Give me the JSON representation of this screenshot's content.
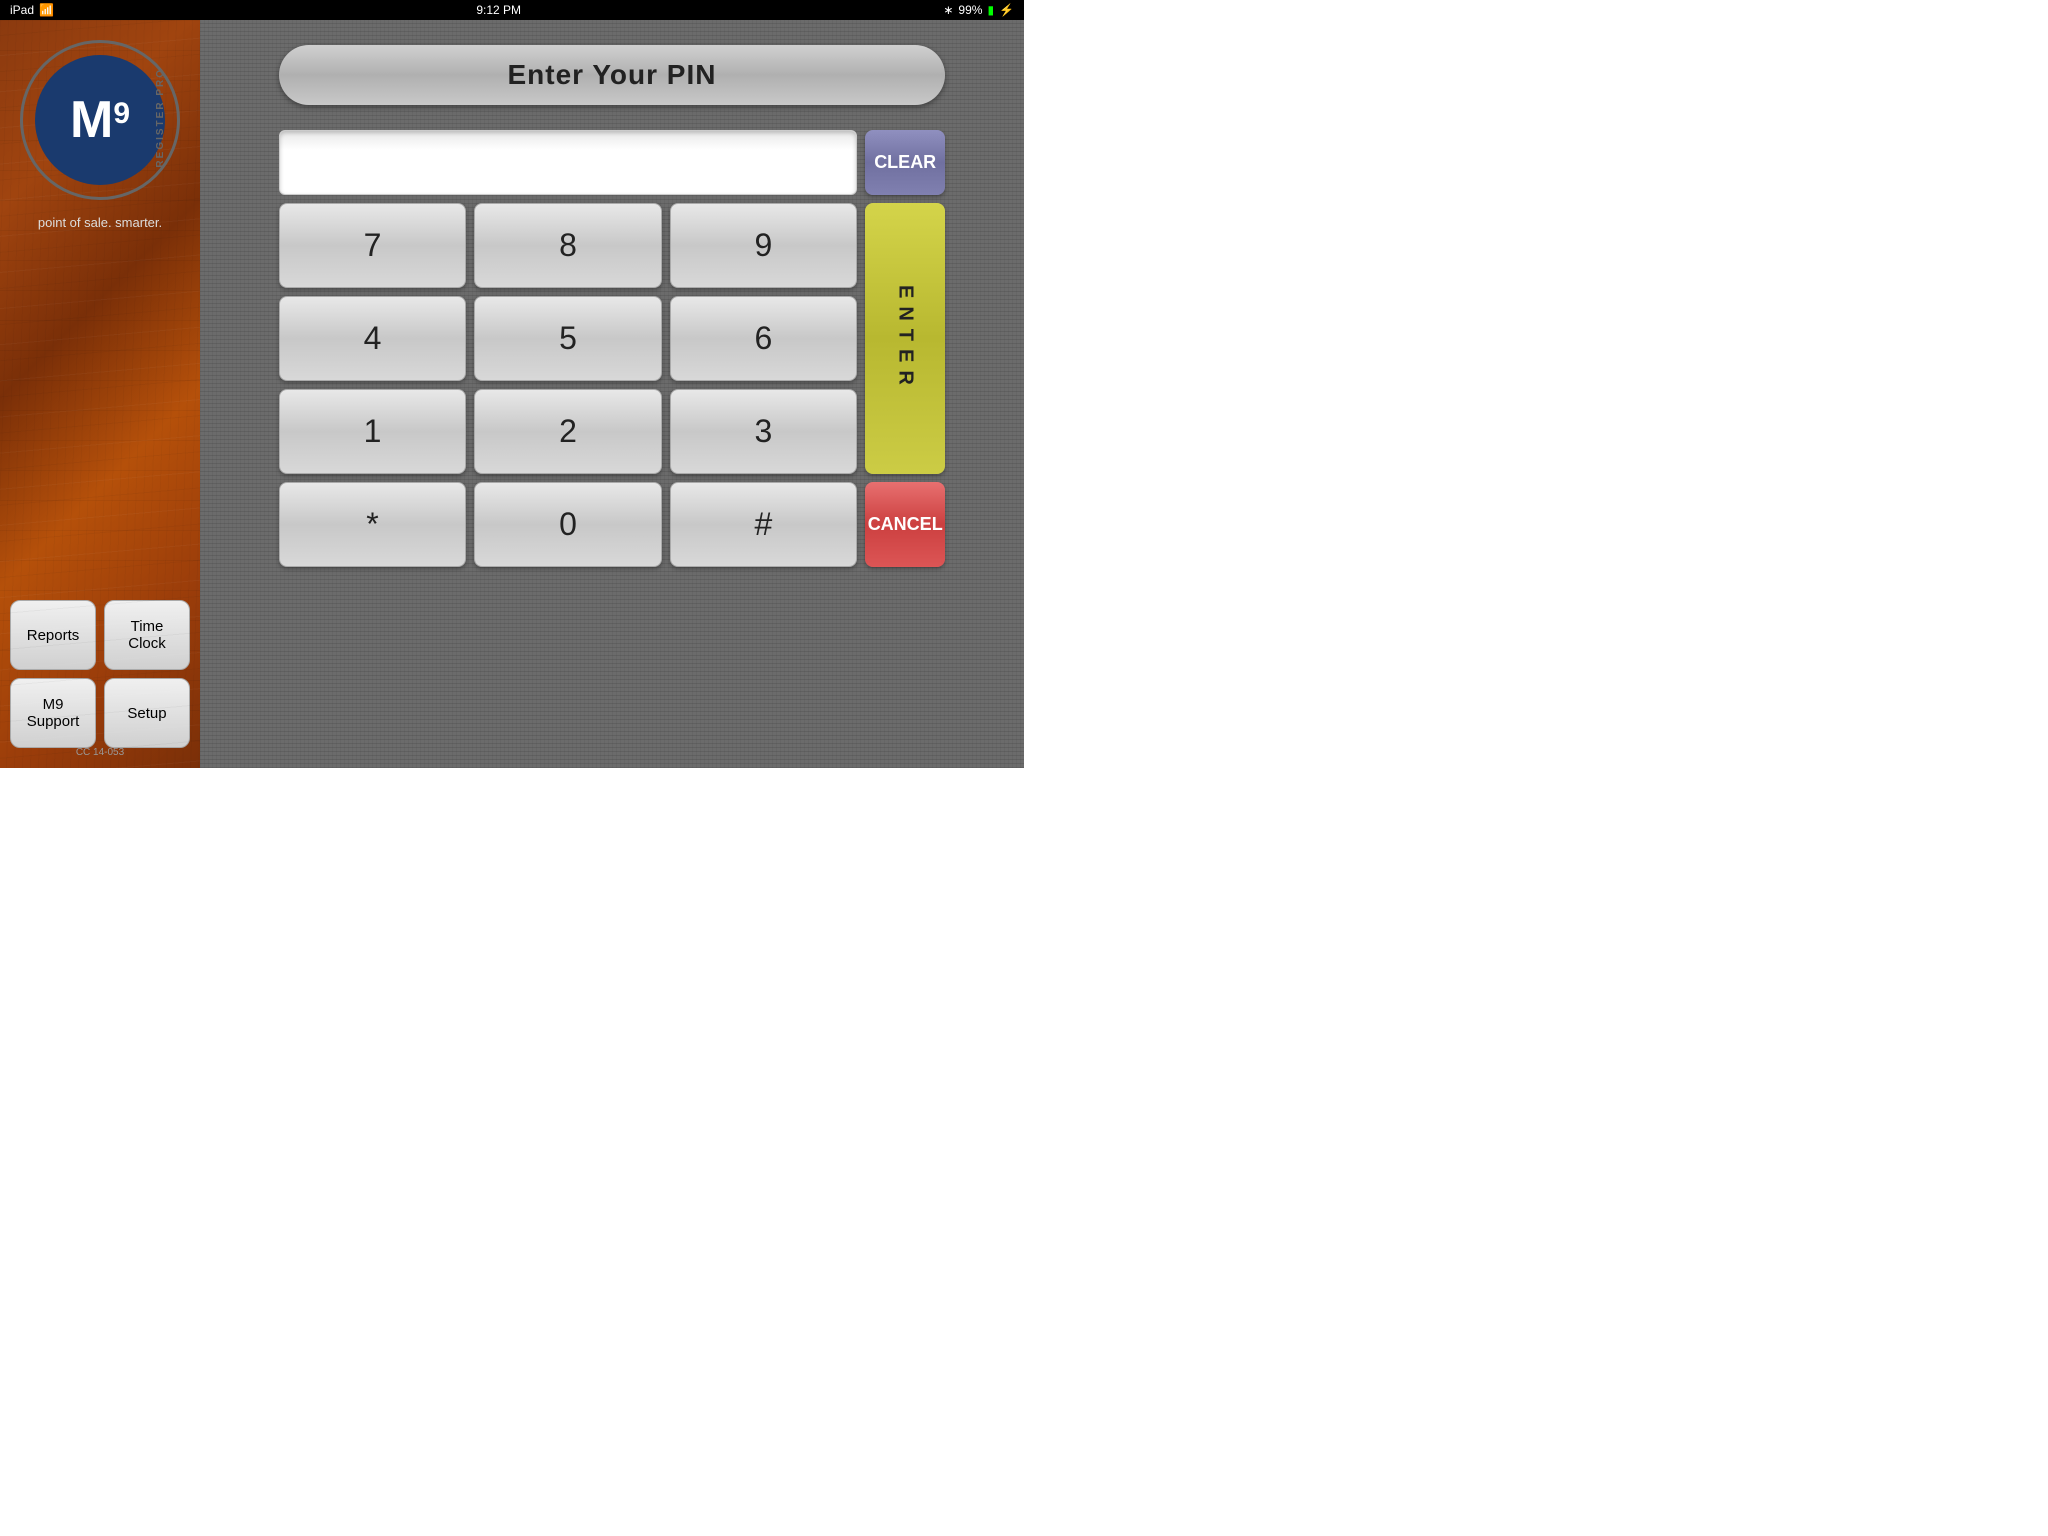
{
  "statusBar": {
    "leftText": "iPad",
    "wifiIcon": "wifi-icon",
    "time": "9:12 PM",
    "bluetoothIcon": "bluetooth-icon",
    "batteryPercent": "99%",
    "batteryIcon": "battery-icon"
  },
  "sidebar": {
    "logo": {
      "letter": "M",
      "superscript": "9",
      "arcText": "REGISTER PRO"
    },
    "tagline": "point of sale. smarter.",
    "buttons": [
      {
        "id": "reports",
        "label": "Reports"
      },
      {
        "id": "time-clock",
        "label": "Time Clock"
      },
      {
        "id": "m9-support",
        "label": "M9 Support"
      },
      {
        "id": "setup",
        "label": "Setup"
      }
    ],
    "copyright": "CC 14-053"
  },
  "pinPanel": {
    "headerText": "Enter Your PIN",
    "clearLabel": "CLEAR",
    "enterLabel": "E\nN\nT\nE\nR",
    "cancelLabel": "CANCEL",
    "keys": [
      {
        "id": "7",
        "label": "7"
      },
      {
        "id": "8",
        "label": "8"
      },
      {
        "id": "9",
        "label": "9"
      },
      {
        "id": "4",
        "label": "4"
      },
      {
        "id": "5",
        "label": "5"
      },
      {
        "id": "6",
        "label": "6"
      },
      {
        "id": "1",
        "label": "1"
      },
      {
        "id": "2",
        "label": "2"
      },
      {
        "id": "3",
        "label": "3"
      },
      {
        "id": "star",
        "label": "*"
      },
      {
        "id": "0",
        "label": "0"
      },
      {
        "id": "hash",
        "label": "#"
      }
    ]
  }
}
